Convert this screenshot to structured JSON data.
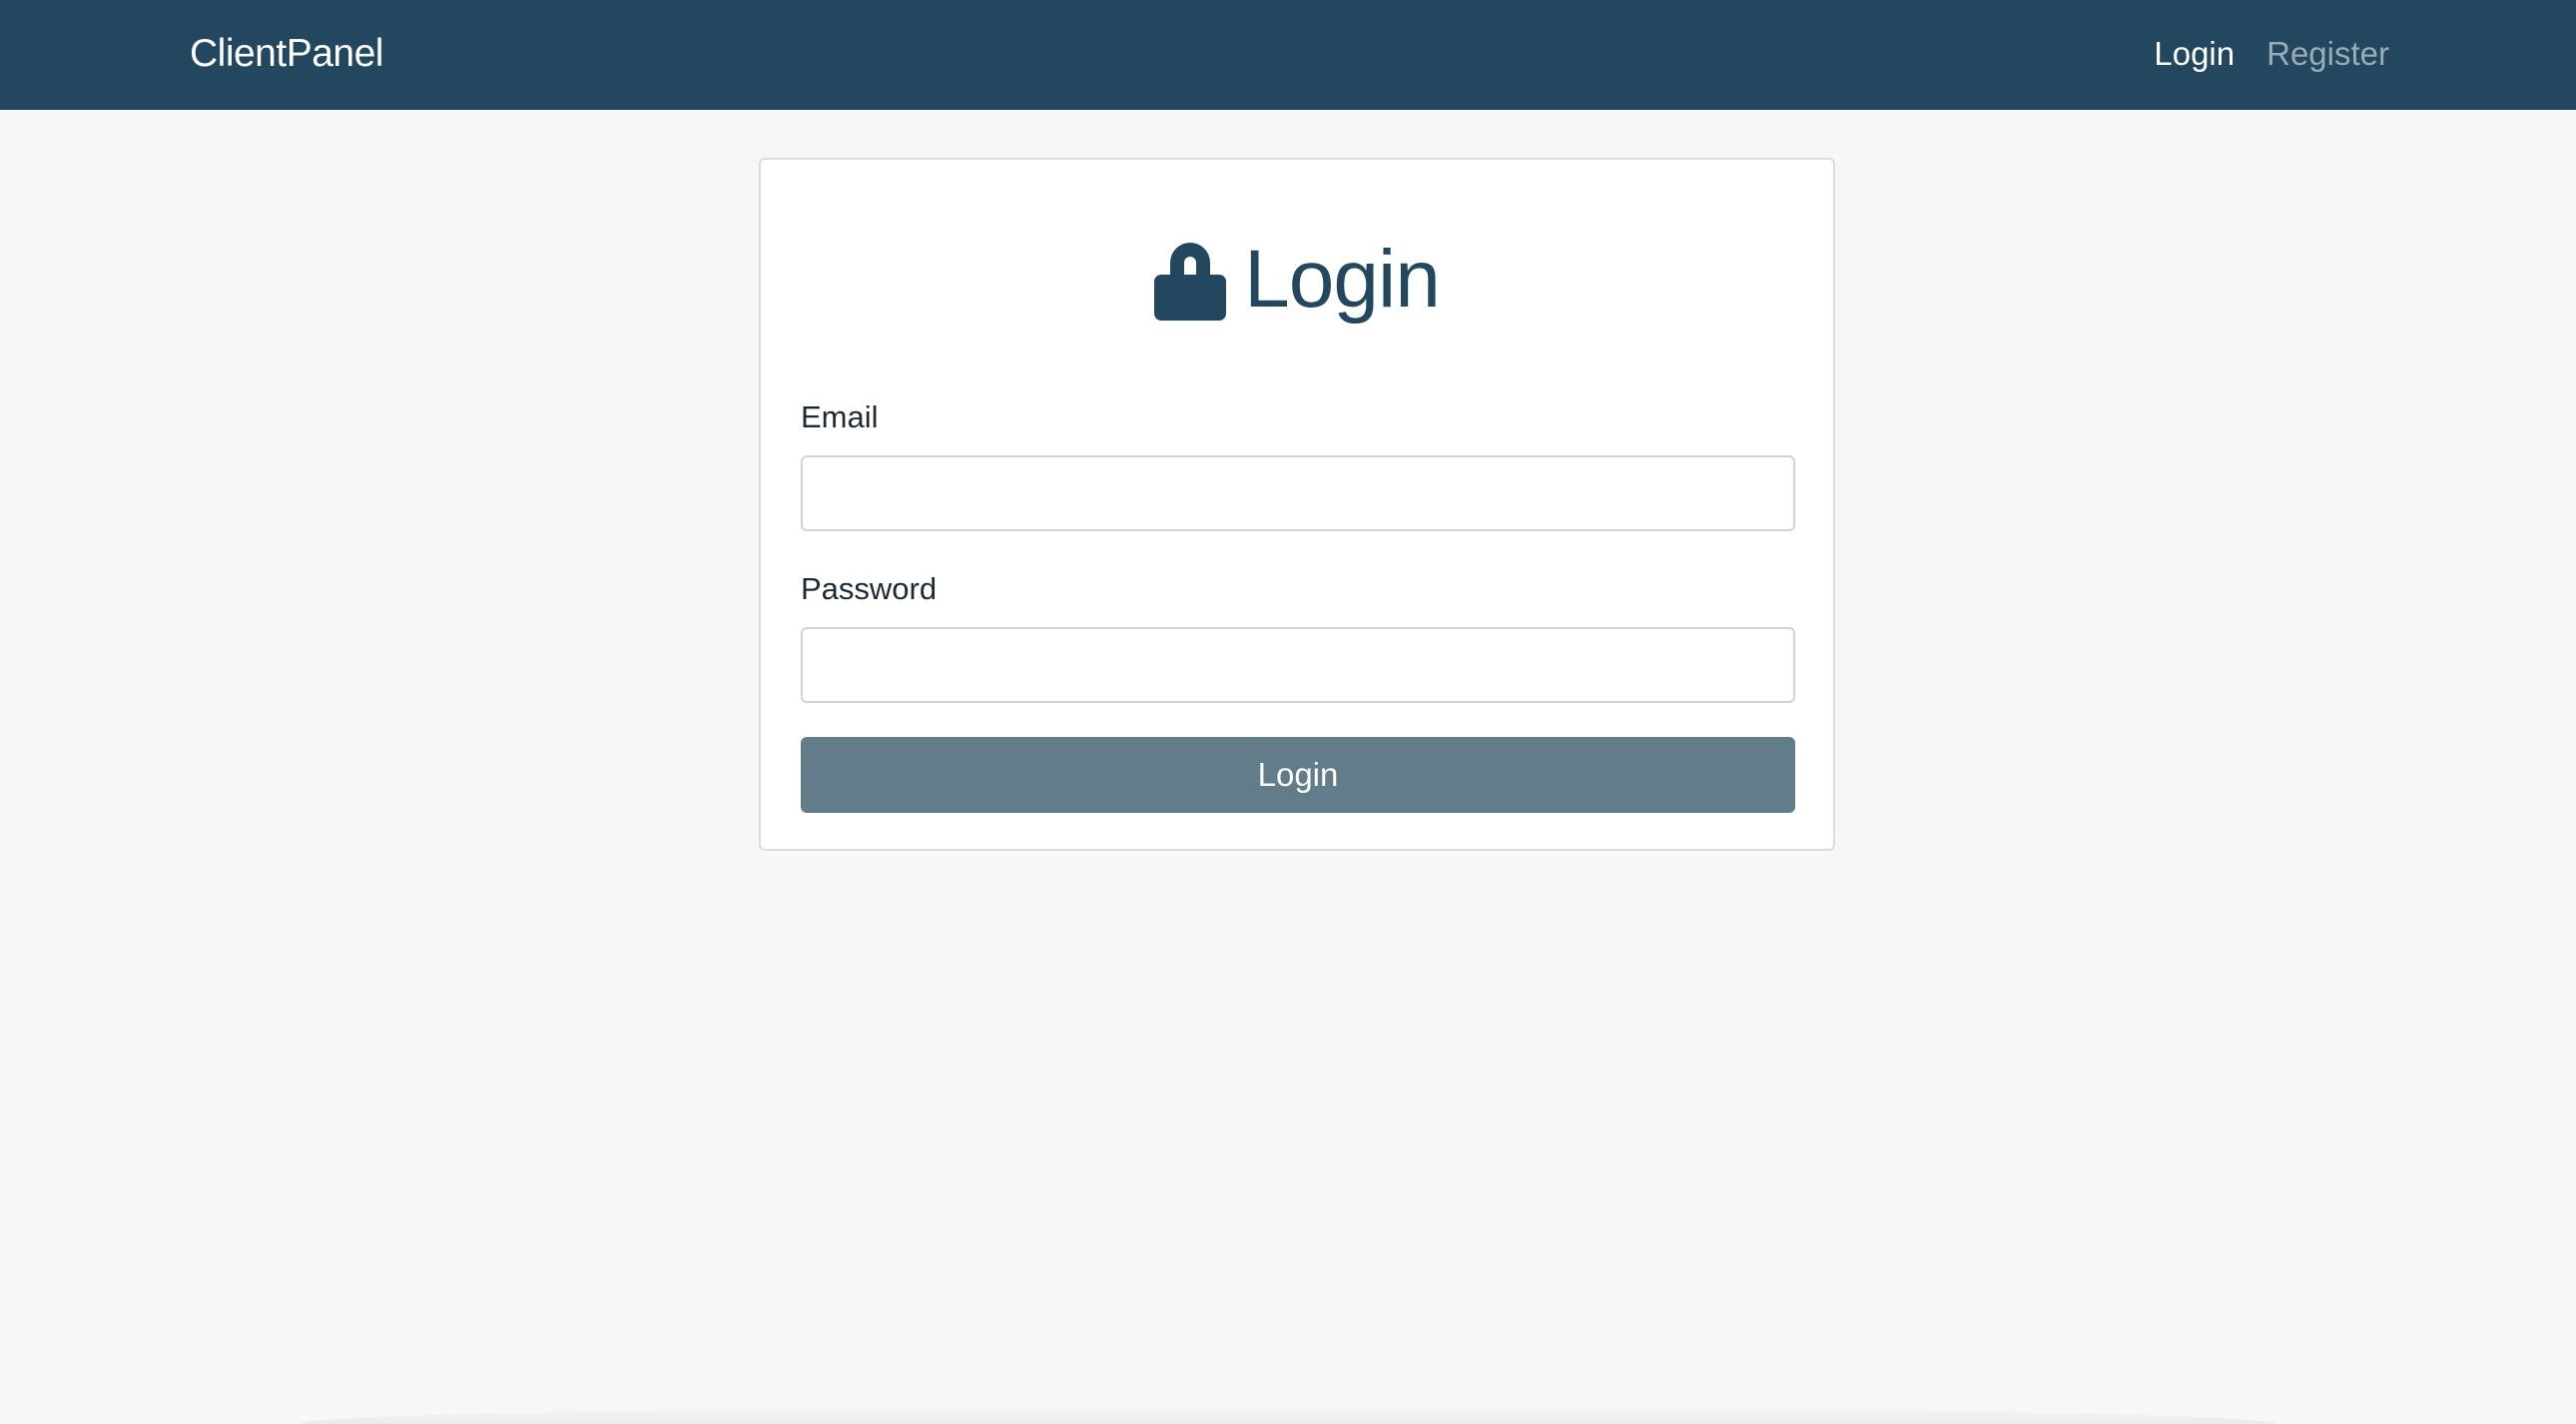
{
  "navbar": {
    "brand": "ClientPanel",
    "links": [
      {
        "label": "Login",
        "active": true
      },
      {
        "label": "Register",
        "active": false
      }
    ]
  },
  "login_form": {
    "title": "Login",
    "title_icon": "lock-icon",
    "email_label": "Email",
    "email_value": "",
    "password_label": "Password",
    "password_value": "",
    "submit_label": "Login"
  },
  "colors": {
    "navbar_bg": "#22475e",
    "page_bg": "#f7f7f7",
    "title_color": "#22475e",
    "button_bg": "#627c8a",
    "link_muted": "#9aabb8"
  }
}
